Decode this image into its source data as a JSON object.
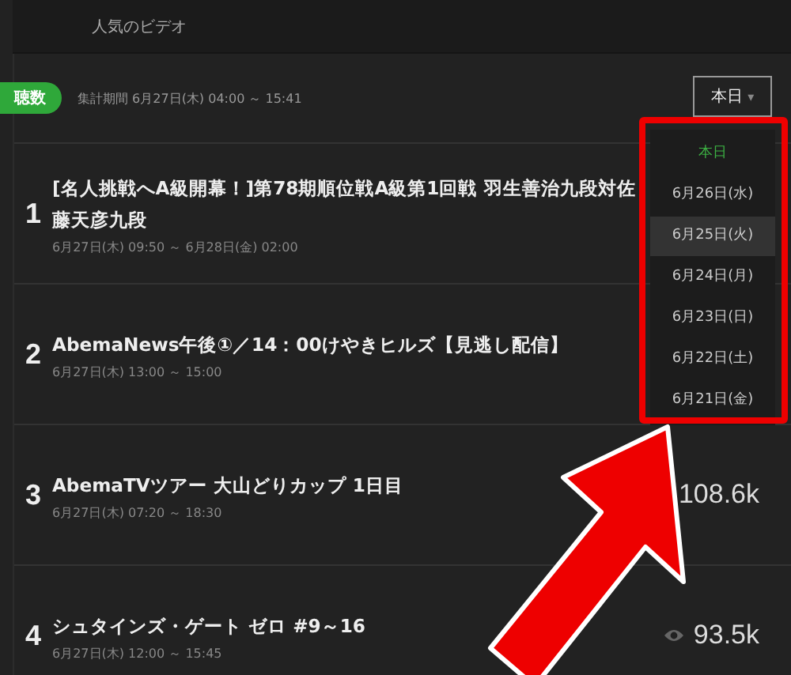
{
  "header": {
    "tab": "人気のビデオ"
  },
  "filter": {
    "badge": "聴数",
    "period": "集計期間 6月27日(木) 04:00 ～ 15:41",
    "dropdown": {
      "value": "本日",
      "caret": "▾",
      "expanded": true,
      "options": [
        {
          "label": "本日",
          "selected": true,
          "hovered": false
        },
        {
          "label": "6月26日(水)",
          "selected": false,
          "hovered": false
        },
        {
          "label": "6月25日(火)",
          "selected": false,
          "hovered": true
        },
        {
          "label": "6月24日(月)",
          "selected": false,
          "hovered": false
        },
        {
          "label": "6月23日(日)",
          "selected": false,
          "hovered": false
        },
        {
          "label": "6月22日(土)",
          "selected": false,
          "hovered": false
        },
        {
          "label": "6月21日(金)",
          "selected": false,
          "hovered": false
        }
      ]
    }
  },
  "rows": [
    {
      "rank": "1",
      "title": "[名人挑戦へA級開幕！]第78期順位戦A級第1回戦 羽生善治九段対佐藤天彦九段",
      "time": "6月27日(木) 09:50 ～ 6月28日(金) 02:00"
    },
    {
      "rank": "2",
      "title": "AbemaNews午後①／14：00けやきヒルズ【見逃し配信】",
      "time": "6月27日(木) 13:00 ～ 15:00"
    },
    {
      "rank": "3",
      "title": "AbemaTVツアー 大山どりカップ 1日目",
      "time": "6月27日(木) 07:20 ～ 18:30",
      "views": "108.6k"
    },
    {
      "rank": "4",
      "title": "シュタインズ・ゲート ゼロ #9～16",
      "time": "6月27日(木) 12:00 ～ 15:45",
      "views": "93.5k"
    }
  ]
}
